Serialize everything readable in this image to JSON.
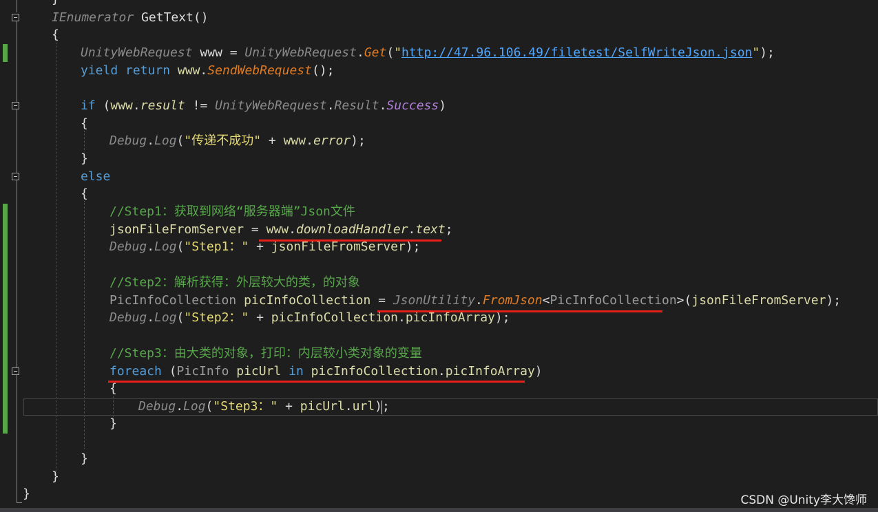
{
  "editor": {
    "lines": [
      {
        "id": "l0",
        "tokens": [
          {
            "c": "t",
            "v": "}"
          }
        ]
      },
      {
        "id": "l1",
        "tokens": [
          {
            "c": "cls",
            "v": "IEnumerator"
          },
          {
            "c": "t",
            "v": " GetText()"
          }
        ]
      },
      {
        "id": "l2",
        "tokens": [
          {
            "c": "t",
            "v": "{"
          }
        ]
      },
      {
        "id": "l3",
        "tokens": [
          {
            "c": "cls",
            "v": "UnityWebRequest"
          },
          {
            "c": "t",
            "v": " www = "
          },
          {
            "c": "cls",
            "v": "UnityWebRequest"
          },
          {
            "c": "t",
            "v": "."
          },
          {
            "c": "mth",
            "v": "Get"
          },
          {
            "c": "t",
            "v": "("
          },
          {
            "c": "str",
            "v": "\""
          },
          {
            "c": "url",
            "v": "http://47.96.106.49/filetest/SelfWriteJson.json"
          },
          {
            "c": "str",
            "v": "\""
          },
          {
            "c": "t",
            "v": ");"
          }
        ]
      },
      {
        "id": "l4",
        "tokens": [
          {
            "c": "kw",
            "v": "yield"
          },
          {
            "c": "t",
            "v": " "
          },
          {
            "c": "kw",
            "v": "return"
          },
          {
            "c": "t",
            "v": " "
          },
          {
            "c": "var",
            "v": "www"
          },
          {
            "c": "t",
            "v": "."
          },
          {
            "c": "mth",
            "v": "SendWebRequest"
          },
          {
            "c": "t",
            "v": "();"
          }
        ]
      },
      {
        "id": "l5",
        "tokens": []
      },
      {
        "id": "l6",
        "tokens": [
          {
            "c": "kw",
            "v": "if"
          },
          {
            "c": "t",
            "v": " ("
          },
          {
            "c": "var",
            "v": "www"
          },
          {
            "c": "t",
            "v": "."
          },
          {
            "c": "prop",
            "v": "result"
          },
          {
            "c": "t",
            "v": " != "
          },
          {
            "c": "cls",
            "v": "UnityWebRequest"
          },
          {
            "c": "t",
            "v": "."
          },
          {
            "c": "cls",
            "v": "Result"
          },
          {
            "c": "t",
            "v": "."
          },
          {
            "c": "enm",
            "v": "Success"
          },
          {
            "c": "t",
            "v": ")"
          }
        ]
      },
      {
        "id": "l7",
        "tokens": [
          {
            "c": "t",
            "v": "{"
          }
        ]
      },
      {
        "id": "l8",
        "tokens": [
          {
            "c": "cls",
            "v": "Debug"
          },
          {
            "c": "t",
            "v": "."
          },
          {
            "c": "cls",
            "v": "Log"
          },
          {
            "c": "t",
            "v": "("
          },
          {
            "c": "str",
            "v": "\"传递不成功\""
          },
          {
            "c": "t",
            "v": " + "
          },
          {
            "c": "var",
            "v": "www"
          },
          {
            "c": "t",
            "v": "."
          },
          {
            "c": "prop",
            "v": "error"
          },
          {
            "c": "t",
            "v": ");"
          }
        ]
      },
      {
        "id": "l9",
        "tokens": [
          {
            "c": "t",
            "v": "}"
          }
        ]
      },
      {
        "id": "l10",
        "tokens": [
          {
            "c": "kw",
            "v": "else"
          }
        ]
      },
      {
        "id": "l11",
        "tokens": [
          {
            "c": "t",
            "v": "{"
          }
        ]
      },
      {
        "id": "l12",
        "tokens": [
          {
            "c": "cmt",
            "v": "//Step1：获取到网络“服务器端”Json文件"
          }
        ]
      },
      {
        "id": "l13",
        "tokens": [
          {
            "c": "var",
            "v": "jsonFileFromServer"
          },
          {
            "c": "t",
            "v": " = "
          },
          {
            "c": "var",
            "v": "www"
          },
          {
            "c": "t",
            "v": "."
          },
          {
            "c": "prop",
            "v": "downloadHandler"
          },
          {
            "c": "t",
            "v": "."
          },
          {
            "c": "prop",
            "v": "text"
          },
          {
            "c": "t",
            "v": ";"
          }
        ]
      },
      {
        "id": "l14",
        "tokens": [
          {
            "c": "cls",
            "v": "Debug"
          },
          {
            "c": "t",
            "v": "."
          },
          {
            "c": "cls",
            "v": "Log"
          },
          {
            "c": "t",
            "v": "("
          },
          {
            "c": "str",
            "v": "\"Step1：\""
          },
          {
            "c": "t",
            "v": " + "
          },
          {
            "c": "var",
            "v": "jsonFileFromServer"
          },
          {
            "c": "t",
            "v": ");"
          }
        ]
      },
      {
        "id": "l15",
        "tokens": []
      },
      {
        "id": "l16",
        "tokens": [
          {
            "c": "cmt",
            "v": "//Step2：解析获得：外层较大的类，的对象"
          }
        ]
      },
      {
        "id": "l17",
        "tokens": [
          {
            "c": "type",
            "v": "PicInfoCollection"
          },
          {
            "c": "t",
            "v": " "
          },
          {
            "c": "var",
            "v": "picInfoCollection"
          },
          {
            "c": "t",
            "v": " = "
          },
          {
            "c": "cls",
            "v": "JsonUtility"
          },
          {
            "c": "t",
            "v": "."
          },
          {
            "c": "mth",
            "v": "FromJson"
          },
          {
            "c": "t",
            "v": "<"
          },
          {
            "c": "type",
            "v": "PicInfoCollection"
          },
          {
            "c": "t",
            "v": ">("
          },
          {
            "c": "var",
            "v": "jsonFileFromServer"
          },
          {
            "c": "t",
            "v": ");"
          }
        ]
      },
      {
        "id": "l18",
        "tokens": [
          {
            "c": "cls",
            "v": "Debug"
          },
          {
            "c": "t",
            "v": "."
          },
          {
            "c": "cls",
            "v": "Log"
          },
          {
            "c": "t",
            "v": "("
          },
          {
            "c": "str",
            "v": "\"Step2：\""
          },
          {
            "c": "t",
            "v": " + "
          },
          {
            "c": "var",
            "v": "picInfoCollection"
          },
          {
            "c": "t",
            "v": "."
          },
          {
            "c": "var",
            "v": "picInfoArray"
          },
          {
            "c": "t",
            "v": ");"
          }
        ]
      },
      {
        "id": "l19",
        "tokens": []
      },
      {
        "id": "l20",
        "tokens": [
          {
            "c": "cmt",
            "v": "//Step3：由大类的对象，打印：内层较小类对象的变量"
          }
        ]
      },
      {
        "id": "l21",
        "tokens": [
          {
            "c": "kw",
            "v": "foreach"
          },
          {
            "c": "t",
            "v": " ("
          },
          {
            "c": "type",
            "v": "PicInfo"
          },
          {
            "c": "t",
            "v": " "
          },
          {
            "c": "var",
            "v": "picUrl"
          },
          {
            "c": "t",
            "v": " "
          },
          {
            "c": "kw",
            "v": "in"
          },
          {
            "c": "t",
            "v": " "
          },
          {
            "c": "var",
            "v": "picInfoCollection"
          },
          {
            "c": "t",
            "v": "."
          },
          {
            "c": "var",
            "v": "picInfoArray"
          },
          {
            "c": "t",
            "v": ")"
          }
        ]
      },
      {
        "id": "l22",
        "tokens": [
          {
            "c": "t",
            "v": "{"
          }
        ]
      },
      {
        "id": "l23",
        "tokens": [
          {
            "c": "cls",
            "v": "Debug"
          },
          {
            "c": "t",
            "v": "."
          },
          {
            "c": "cls",
            "v": "Log"
          },
          {
            "c": "t",
            "v": "("
          },
          {
            "c": "str",
            "v": "\"Step3：\""
          },
          {
            "c": "t",
            "v": " + "
          },
          {
            "c": "var",
            "v": "picUrl"
          },
          {
            "c": "t",
            "v": "."
          },
          {
            "c": "var",
            "v": "url"
          },
          {
            "c": "t",
            "v": ");"
          }
        ]
      },
      {
        "id": "l24",
        "tokens": [
          {
            "c": "t",
            "v": "}"
          }
        ]
      },
      {
        "id": "l25",
        "tokens": []
      },
      {
        "id": "l26",
        "tokens": [
          {
            "c": "t",
            "v": "}"
          }
        ]
      },
      {
        "id": "l27",
        "tokens": [
          {
            "c": "t",
            "v": "}"
          }
        ]
      },
      {
        "id": "l28",
        "tokens": [
          {
            "c": "t",
            "v": "}"
          }
        ]
      }
    ]
  },
  "watermark": "CSDN @Unity李大馋师",
  "colors": {
    "background": "#1e1e1e",
    "annotation_underline": "#e8201a",
    "changed_line_marker": "#57a64a"
  }
}
